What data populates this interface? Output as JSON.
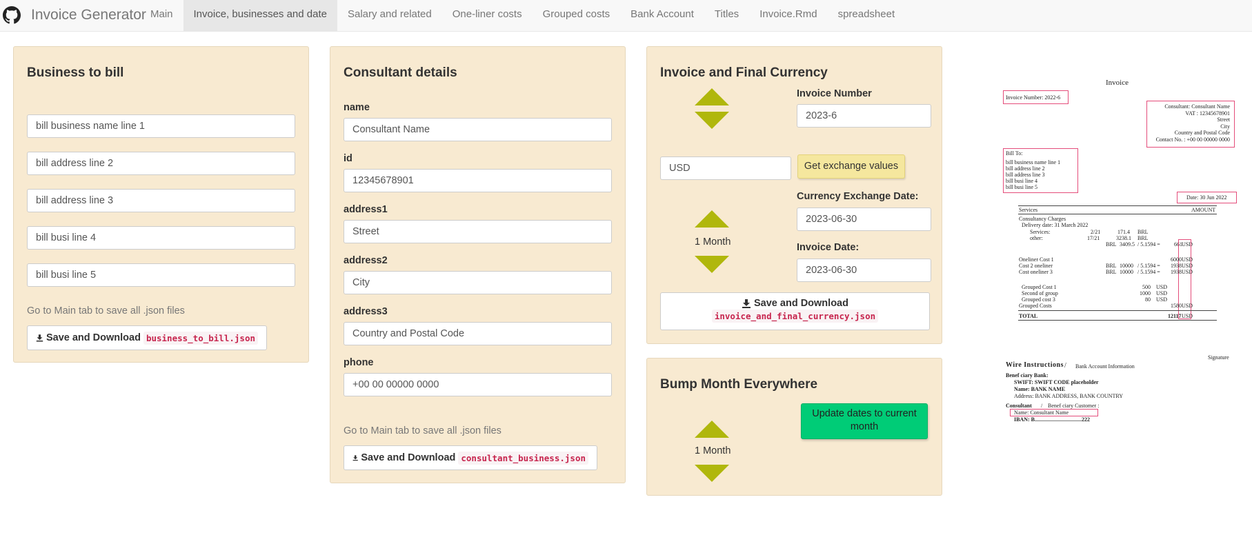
{
  "app": {
    "title": "Invoice Generator",
    "nav": [
      {
        "label": "Main",
        "active": false
      },
      {
        "label": "Invoice, businesses and date",
        "active": true
      },
      {
        "label": "Salary and related",
        "active": false
      },
      {
        "label": "One-liner costs",
        "active": false
      },
      {
        "label": "Grouped costs",
        "active": false
      },
      {
        "label": "Bank Account",
        "active": false
      },
      {
        "label": "Titles",
        "active": false
      },
      {
        "label": "Invoice.Rmd",
        "active": false
      },
      {
        "label": "spreadsheet",
        "active": false
      }
    ]
  },
  "business": {
    "title": "Business to bill",
    "lines": [
      "bill business name line 1",
      "bill address line 2",
      "bill address line 3",
      "bill busi line 4",
      "bill busi line 5"
    ],
    "hint": "Go to Main tab to save all .json files",
    "save_label": "Save and Download",
    "save_file": "business_to_bill.json"
  },
  "consultant": {
    "title": "Consultant details",
    "fields": [
      {
        "label": "name",
        "value": "Consultant Name"
      },
      {
        "label": "id",
        "value": "12345678901"
      },
      {
        "label": "address1",
        "value": "Street"
      },
      {
        "label": "address2",
        "value": "City"
      },
      {
        "label": "address3",
        "value": "Country and Postal Code"
      },
      {
        "label": "phone",
        "value": "+00 00 00000 0000"
      }
    ],
    "hint": "Go to Main tab to save all .json files",
    "save_label": "Save and Download",
    "save_file": "consultant_business.json"
  },
  "invoice": {
    "title": "Invoice and Final Currency",
    "number_label": "Invoice Number",
    "number_value": "2023-6",
    "currency_value": "USD",
    "exchange_button": "Get exchange values",
    "step_label": "1 Month",
    "exchange_date_label": "Currency Exchange Date:",
    "exchange_date_value": "2023-06-30",
    "invoice_date_label": "Invoice Date:",
    "invoice_date_value": "2023-06-30",
    "save_label": "Save and Download",
    "save_file": "invoice_and_final_currency.json"
  },
  "bump": {
    "title": "Bump Month Everywhere",
    "step_label": "1 Month",
    "update_button": "Update dates to current month"
  },
  "colors": {
    "panel_bg": "#f8ead1",
    "arrow": "#b0b70c",
    "exchange_btn": "#f5e79e",
    "update_btn": "#00cc77",
    "code_text": "#c7254e",
    "highlight_box": "#e44c7a"
  },
  "preview": {
    "title": "Invoice",
    "invoice_number": "Invoice Number: 2022-6",
    "consultant_lines": [
      "Consultant: Consultant Name",
      "VAT : 12345678901",
      "Street",
      "City",
      "Country and Postal Code",
      "Contact No. : +00 00 00000 0000"
    ],
    "bill_to_label": "Bill To:",
    "bill_to_lines": [
      "bill business name line 1",
      "bill address line 2",
      "bill address line 3",
      "bill busi line 4",
      "bill busi line 5"
    ],
    "date": "Date: 30 Jun 2022",
    "services_header": "Services",
    "amount_header": "AMOUNT",
    "consultancy": "Consultancy Charges",
    "delivery": "Delivery date: 31 March 2022",
    "services_row": {
      "label": "Services:",
      "frac": "2/21",
      "value": "171.4",
      "cur": "BRL"
    },
    "other_row": {
      "label": "other:",
      "frac": "17/21",
      "value": "3238.1",
      "cur": "BRL"
    },
    "total_row": {
      "cur": "BRL",
      "value": "3409.5",
      "rate": "/ 5.1594 =",
      "amount": "661",
      "unit": "USD"
    },
    "oneliners": [
      {
        "label": "Oneliner Cost 1",
        "cur": "",
        "value": "",
        "rate": "",
        "amount": "6000",
        "unit": "USD"
      },
      {
        "label": "Cost 2 oneliner",
        "cur": "BRL",
        "value": "10000",
        "rate": "/ 5.1594 =",
        "amount": "1938",
        "unit": "USD"
      },
      {
        "label": "Cost oneliner 3",
        "cur": "BRL",
        "value": "10000",
        "rate": "/ 5.1594 =",
        "amount": "1938",
        "unit": "USD"
      }
    ],
    "grouped": [
      {
        "label": "Grouped Cost 1",
        "value": "500",
        "unit": "USD"
      },
      {
        "label": "Second of group",
        "value": "1000",
        "unit": "USD"
      },
      {
        "label": "Grouped cost 3",
        "value": "80",
        "unit": "USD"
      }
    ],
    "grouped_total": {
      "label": "Grouped Costs",
      "amount": "1580",
      "unit": "USD"
    },
    "grand_total": {
      "label": "TOTAL",
      "amount": "12117",
      "unit": "USD"
    },
    "signature": "Signature",
    "wire_title": "Wire Instructions",
    "wire_sub": "Bank Account Information",
    "beneficiary_bank": "Benef ciary Bank:",
    "swift": "SWIFT: SWIFT CODE placeholder",
    "bank_name": "Name: BANK NAME",
    "bank_address": "Address: BANK ADDRESS, BANK COUNTRY",
    "consultant_label": "Consultant",
    "beneficiary_customer": "Benef ciary Customer :",
    "cust_name": "Name: Consultant Name",
    "iban": "IBAN: B..................................222"
  }
}
